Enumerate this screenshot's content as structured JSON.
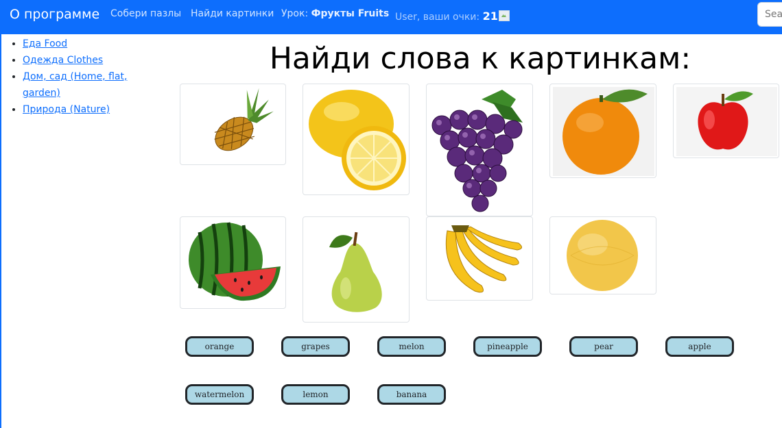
{
  "navbar": {
    "brand": "О программе",
    "links": [
      "Собери пазлы",
      "Найди картинки"
    ],
    "lesson_prefix": "Урок:",
    "lesson_name": "Фрукты Fruits",
    "user_prefix": "User, ваши очки:",
    "score": "21",
    "search_placeholder": "Search"
  },
  "sidebar": {
    "items": [
      {
        "label": "Еда Food"
      },
      {
        "label": "Одежда Clothes"
      },
      {
        "label": "Дом, сад (Home, flat, garden)"
      },
      {
        "label": "Природа (Nature)"
      }
    ]
  },
  "main": {
    "title": "Найди слова к картинкам:",
    "pictures": [
      {
        "icon": "pineapple-image"
      },
      {
        "icon": "lemon-image"
      },
      {
        "icon": "grapes-image"
      },
      {
        "icon": "orange-image"
      },
      {
        "icon": "apple-image"
      },
      {
        "icon": "watermelon-image"
      },
      {
        "icon": "pear-image"
      },
      {
        "icon": "banana-image"
      },
      {
        "icon": "melon-image"
      }
    ],
    "words": [
      "orange",
      "grapes",
      "melon",
      "pineapple",
      "pear",
      "apple",
      "watermelon",
      "lemon",
      "banana"
    ]
  },
  "colors": {
    "navbar": "#0d6efd",
    "word_button": "#add8e6"
  }
}
